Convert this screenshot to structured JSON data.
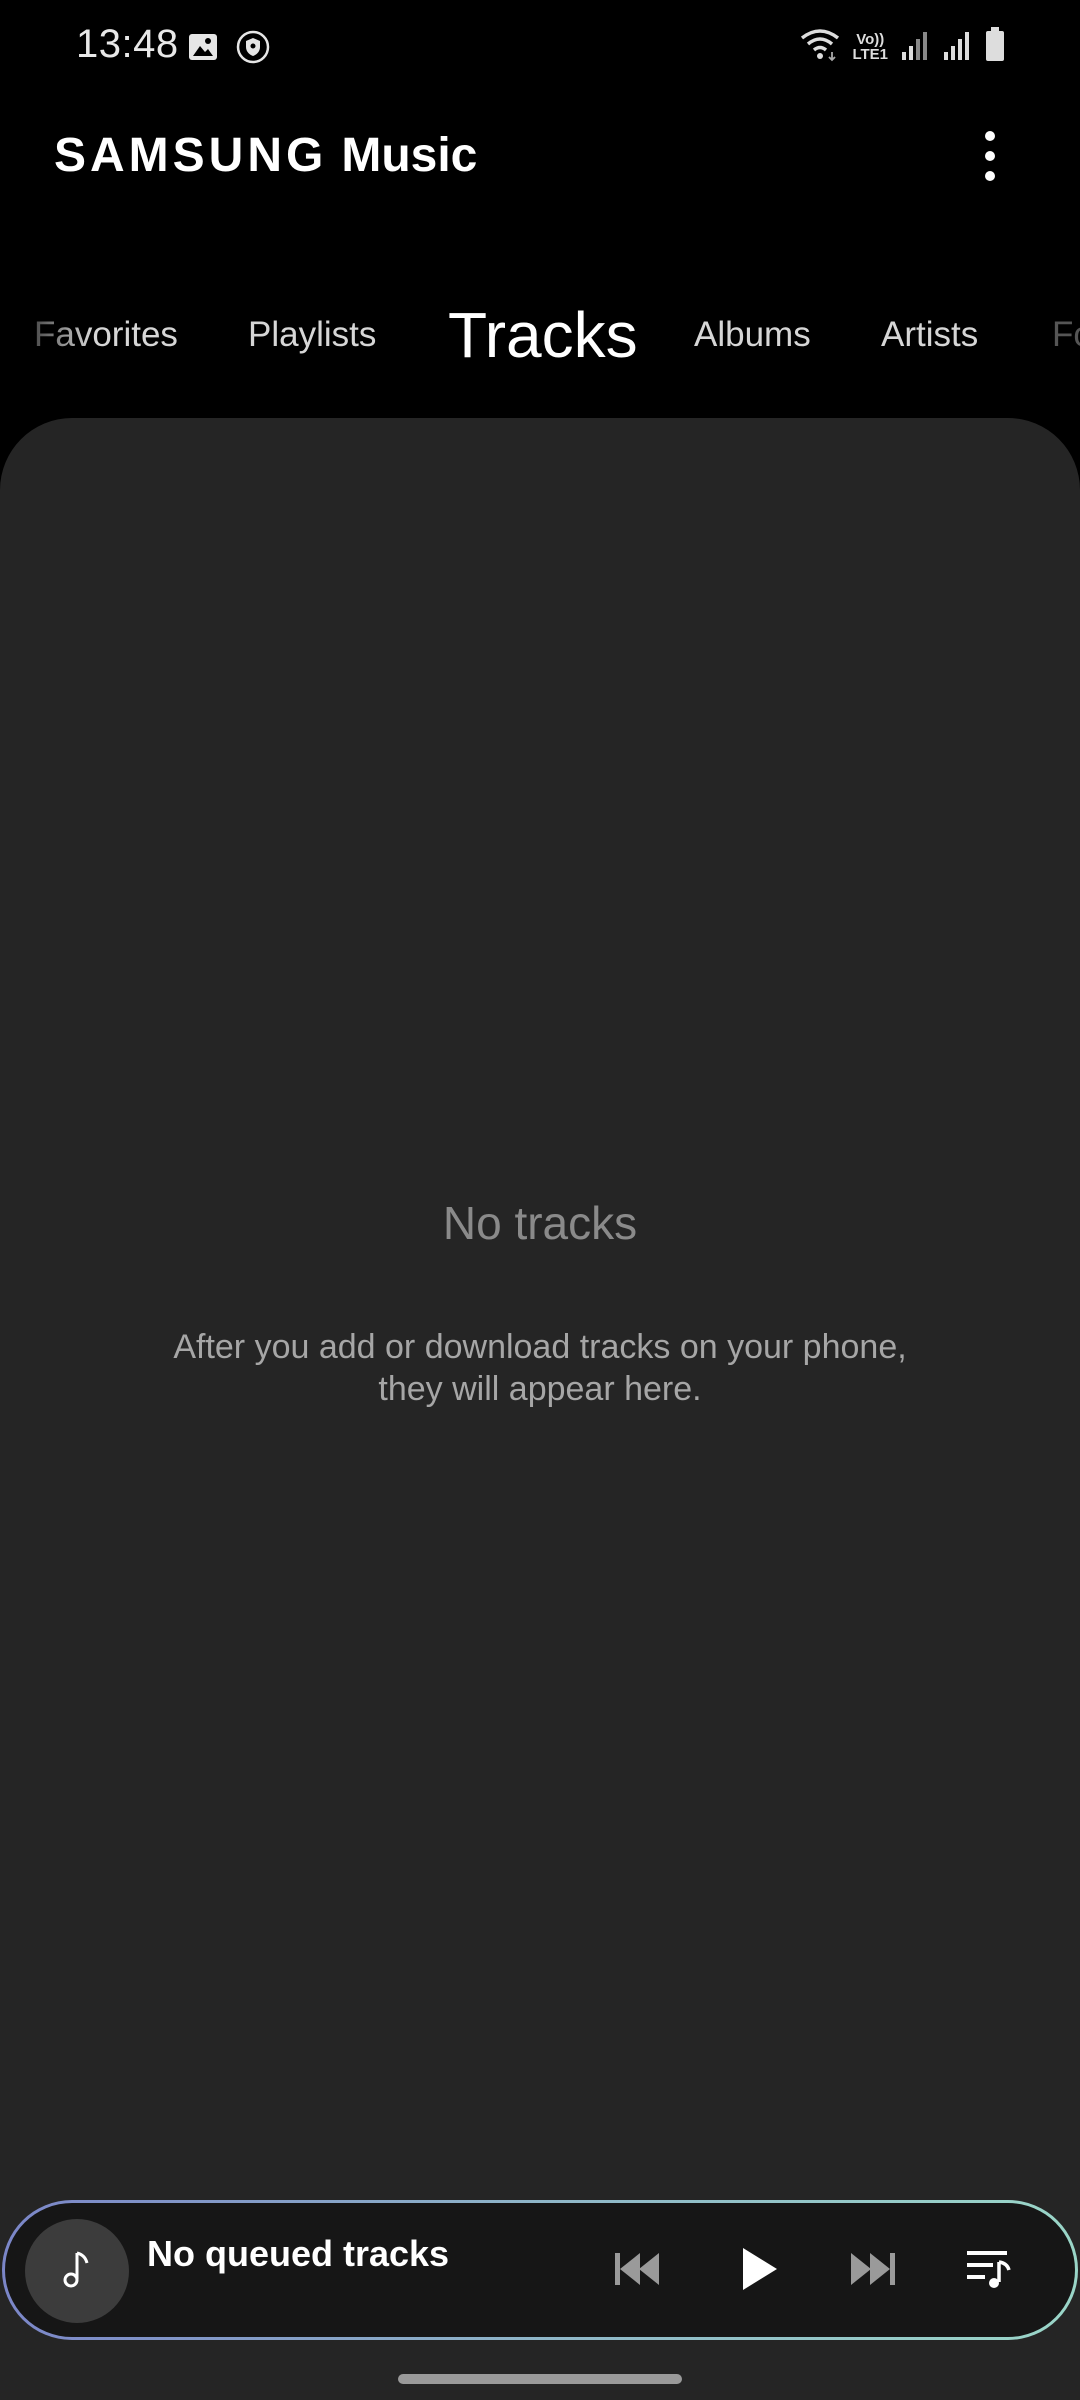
{
  "status_bar": {
    "time": "13:48",
    "left_icons": [
      "gallery-icon",
      "shield-icon"
    ],
    "right_icons": [
      "wifi-icon",
      "volte-icon",
      "signal-icon",
      "signal-icon",
      "battery-icon"
    ],
    "volte_top": "Vo))",
    "volte_bottom": "LTE1"
  },
  "app_bar": {
    "brand": "SAMSUNG",
    "title": "Music",
    "more_icon": "more-vert-icon"
  },
  "tabs": [
    {
      "label": "Favorites"
    },
    {
      "label": "Playlists"
    },
    {
      "label": "Tracks",
      "active": true
    },
    {
      "label": "Albums"
    },
    {
      "label": "Artists"
    },
    {
      "label": "Fo"
    }
  ],
  "empty_state": {
    "title": "No tracks",
    "description": "After you add or download tracks on your phone, they will appear here."
  },
  "mini_player": {
    "title": "No queued tracks",
    "icons": [
      "music-note-icon",
      "previous-icon",
      "play-icon",
      "next-icon",
      "queue-icon"
    ]
  },
  "colors": {
    "background": "#000000",
    "panel": "#252525",
    "gradient_start": "#7b86c8",
    "gradient_end": "#9ad6c8"
  }
}
